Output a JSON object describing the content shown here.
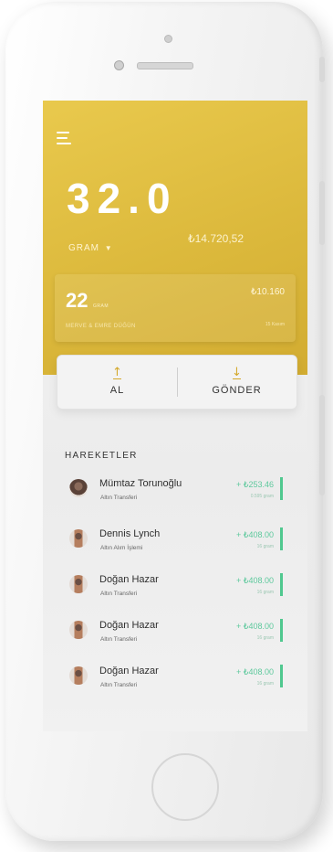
{
  "hero": {
    "balance": "32.0",
    "balance_tl": "₺14.720,52",
    "unit": "GRAM",
    "caret": "▼"
  },
  "card": {
    "amount_gram": "22",
    "unit": "GRAM",
    "amount_tl": "₺10.160",
    "name": "MERVE & EMRE DÜĞÜN",
    "date": "15 Kasım"
  },
  "actions": {
    "buy": "AL",
    "send": "GÖNDER"
  },
  "section": {
    "title": "HAREKETLER"
  },
  "transactions": [
    {
      "name": "Mümtaz Torunoğlu",
      "type": "Altın Transferi",
      "amount": "+ ₺253.46",
      "gram": "0.595 gram"
    },
    {
      "name": "Dennis Lynch",
      "type": "Altın Alım İşlemi",
      "amount": "+ ₺408.00",
      "gram": "16 gram"
    },
    {
      "name": "Doğan Hazar",
      "type": "Altın Transferi",
      "amount": "+ ₺408.00",
      "gram": "16 gram"
    },
    {
      "name": "Doğan Hazar",
      "type": "Altın Transferi",
      "amount": "+ ₺408.00",
      "gram": "16 gram"
    },
    {
      "name": "Doğan Hazar",
      "type": "Altın Transferi",
      "amount": "+ ₺408.00",
      "gram": "16 gram"
    }
  ],
  "colors": {
    "gold": "#dcb93c",
    "positive": "#50c88f"
  },
  "icons": {
    "menu": "hamburger-menu-icon",
    "buy": "arrow-up-icon",
    "send": "arrow-down-icon"
  }
}
